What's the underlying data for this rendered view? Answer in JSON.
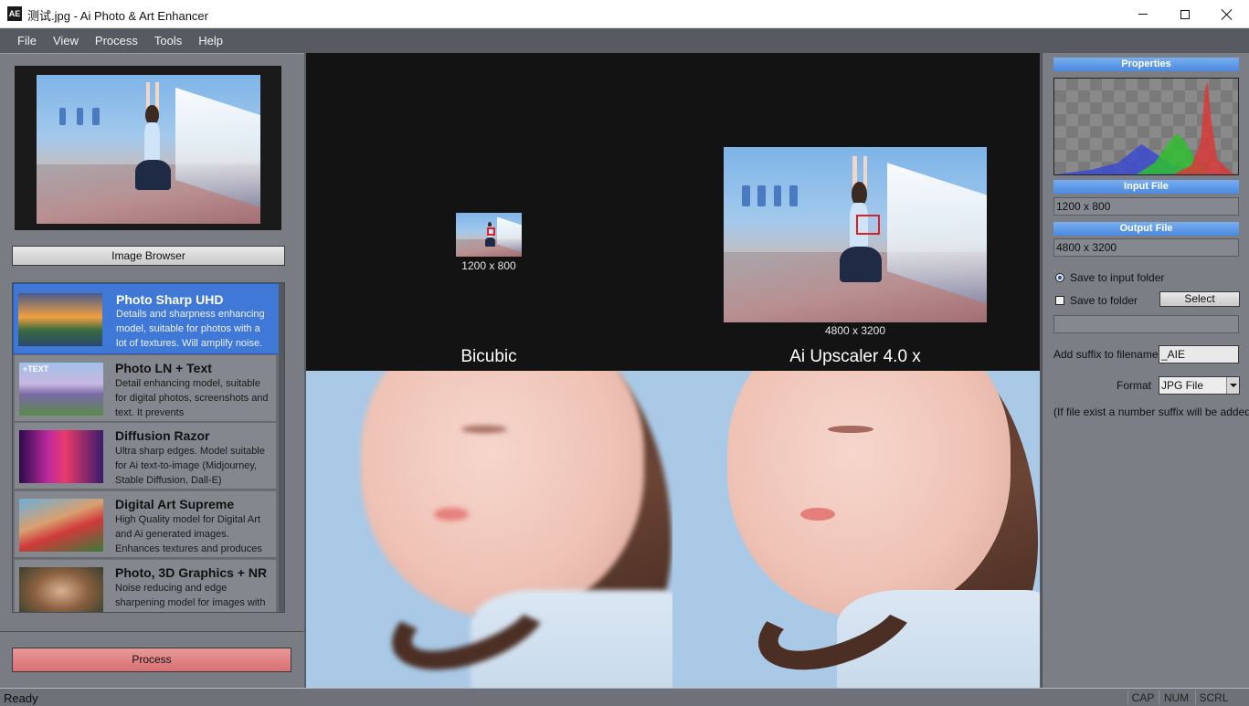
{
  "window": {
    "title": "测试.jpg - Ai Photo & Art Enhancer",
    "icon_text": "AE",
    "minimize_icon": "minimize-icon",
    "maximize_icon": "maximize-icon",
    "close_icon": "close-icon"
  },
  "menu": [
    "File",
    "View",
    "Process",
    "Tools",
    "Help"
  ],
  "left": {
    "image_browser_label": "Image Browser",
    "process_label": "Process",
    "models": [
      {
        "name": "Photo Sharp UHD",
        "desc": "Details and sharpness enhancing model, suitable for photos with a lot of textures. Will amplify noise.",
        "selected": true
      },
      {
        "name": "Photo LN + Text",
        "desc": "Detail enhancing model, suitable for digital photos, screenshots and text. It prevents",
        "thumb_text": "+TEXT"
      },
      {
        "name": "Diffusion Razor",
        "desc": "Ultra sharp edges. Model suitable for Ai text-to-image (Midjourney, Stable Diffusion, Dall-E)"
      },
      {
        "name": "Digital Art Supreme",
        "desc": "High Quality model for Digital Art and Ai generated images. Enhances textures and produces"
      },
      {
        "name": "Photo, 3D Graphics + NR",
        "desc": "Noise reducing and edge sharpening model for images with"
      }
    ]
  },
  "center": {
    "input_dim": "1200 x 800",
    "output_dim": "4800 x 3200",
    "left_label": "Bicubic",
    "right_label": "Ai Upscaler 4.0 x"
  },
  "right": {
    "properties_header": "Properties",
    "input_header": "Input File",
    "input_value": "1200 x 800",
    "output_header": "Output File",
    "output_value": "4800 x 3200",
    "save_input_label": "Save to input folder",
    "save_folder_label": "Save to folder",
    "select_label": "Select",
    "folder_path": "",
    "suffix_label": "Add suffix to filename",
    "suffix_value": "_AIE",
    "format_label": "Format",
    "format_value": "JPG File",
    "note": "(If file exist a number suffix will be added)"
  },
  "status": {
    "text": "Ready",
    "cap": "CAP",
    "num": "NUM",
    "scrl": "SCRL"
  },
  "colors": {
    "accent": "#3f78d6",
    "process_button": "#d97073",
    "header_blue": "#4b8ae0",
    "marker_red": "#e02020"
  }
}
